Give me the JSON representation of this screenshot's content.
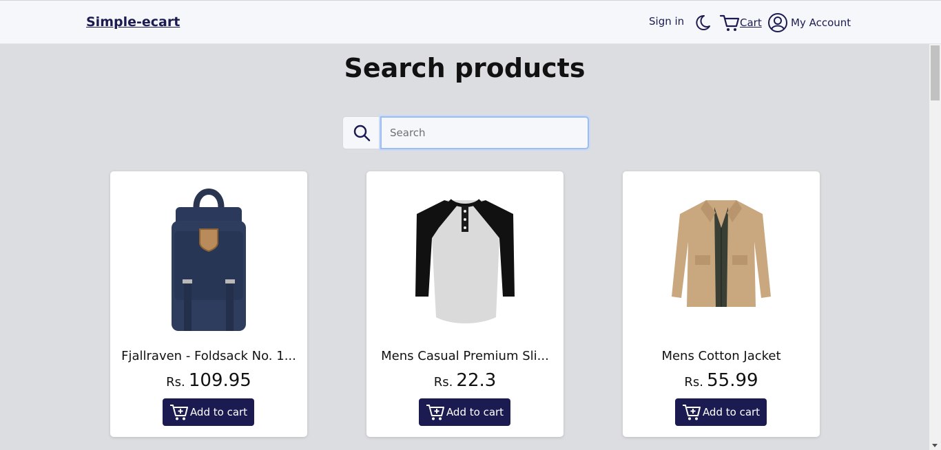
{
  "header": {
    "brand": "Simple-ecart",
    "sign_in": "Sign in",
    "cart": "Cart",
    "account": "My Account"
  },
  "main": {
    "title": "Search products",
    "search": {
      "placeholder": "Search",
      "value": ""
    }
  },
  "products": [
    {
      "name": "Fjallraven - Foldsack No. 1...",
      "currency": "Rs.",
      "price": "109.95",
      "button": "Add to cart",
      "image": "backpack"
    },
    {
      "name": "Mens Casual Premium Sli...",
      "currency": "Rs.",
      "price": "22.3",
      "button": "Add to cart",
      "image": "raglan-tshirt"
    },
    {
      "name": "Mens Cotton Jacket",
      "currency": "Rs.",
      "price": "55.99",
      "button": "Add to cart",
      "image": "jacket"
    }
  ],
  "colors": {
    "brand": "#1b1b52",
    "background": "#dcdde0",
    "navbar": "#f6f7fa"
  }
}
